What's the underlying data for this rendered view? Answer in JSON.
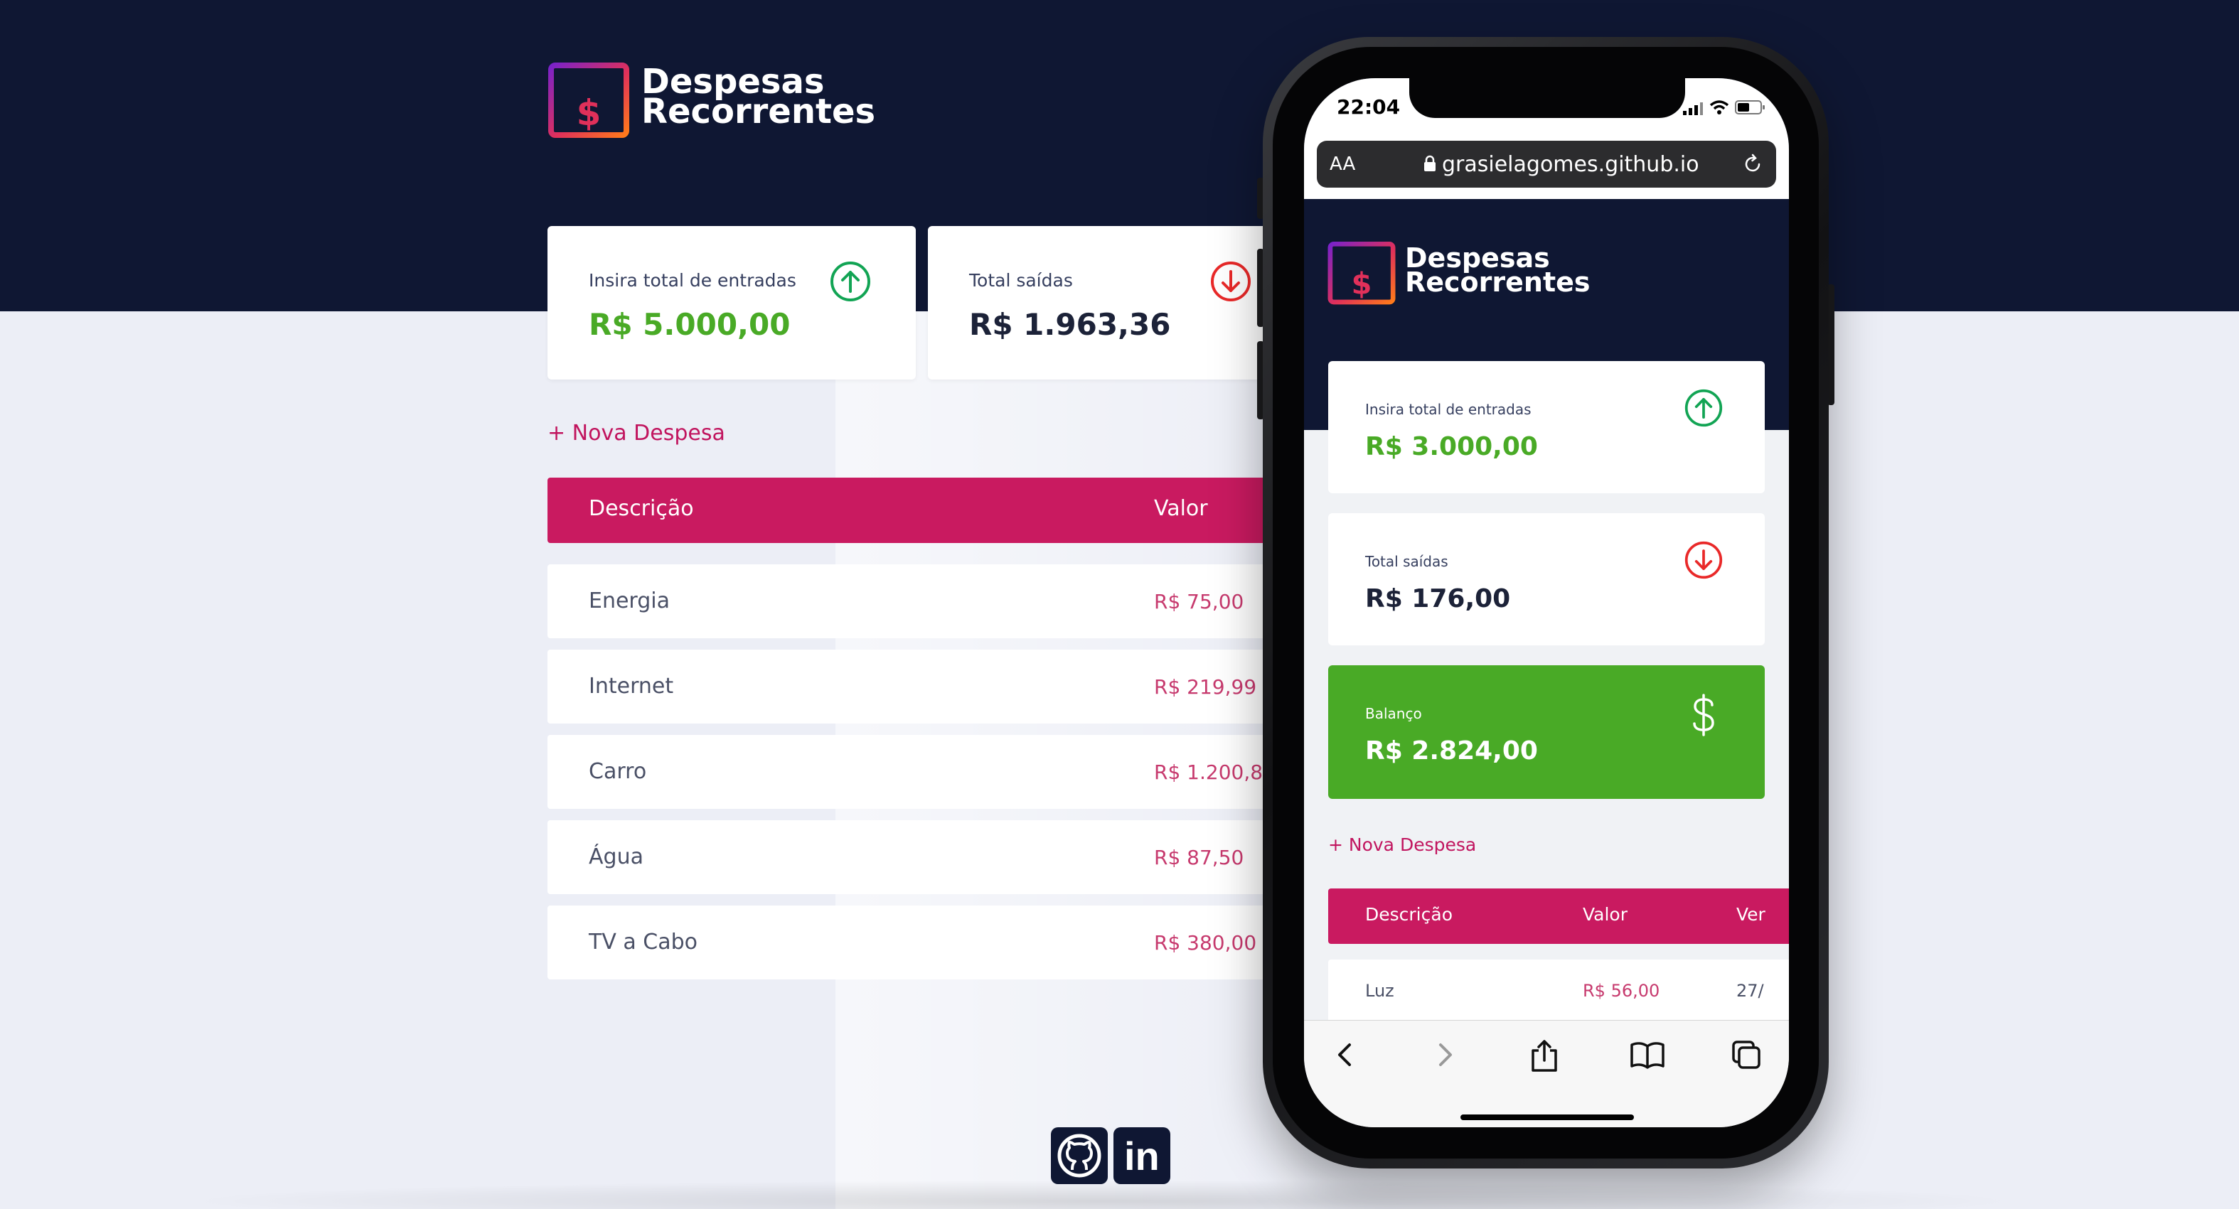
{
  "app": {
    "title_line1": "Despesas",
    "title_line2": "Recorrentes"
  },
  "desktop": {
    "income": {
      "label": "Insira total de entradas",
      "value": "R$ 5.000,00",
      "icon": "arrow-up-circle-icon"
    },
    "expenses": {
      "label": "Total saídas",
      "value": "R$ 1.963,36",
      "icon": "arrow-down-circle-icon"
    },
    "new_expense": "+ Nova Despesa",
    "table": {
      "headers": [
        "Descrição",
        "Valor"
      ],
      "rows": [
        {
          "description": "Energia",
          "value": "R$ 75,00"
        },
        {
          "description": "Internet",
          "value": "R$ 219,99"
        },
        {
          "description": "Carro",
          "value": "R$ 1.200,87"
        },
        {
          "description": "Água",
          "value": "R$ 87,50"
        },
        {
          "description": "TV a Cabo",
          "value": "R$ 380,00"
        }
      ]
    }
  },
  "footer": {
    "links": [
      {
        "name": "GitHub",
        "icon": "github-icon"
      },
      {
        "name": "LinkedIn",
        "icon": "linkedin-icon",
        "text": "in"
      }
    ]
  },
  "mobile": {
    "status": {
      "time": "22:04"
    },
    "browser": {
      "aa": "AA",
      "url": "grasielagomes.github.io"
    },
    "income": {
      "label": "Insira total de entradas",
      "value": "R$ 3.000,00"
    },
    "expenses": {
      "label": "Total saídas",
      "value": "R$ 176,00"
    },
    "balance": {
      "label": "Balanço",
      "value": "R$ 2.824,00",
      "icon": "dollar-sign-icon"
    },
    "new_expense": "+ Nova Despesa",
    "table": {
      "headers": [
        "Descrição",
        "Valor",
        "Ver"
      ],
      "rows": [
        {
          "description": "Luz",
          "value": "R$ 56,00",
          "date": "27/"
        }
      ]
    }
  },
  "colors": {
    "navy": "#0f1733",
    "background": "#eceef6",
    "accent": "#c91a60",
    "income_green": "#49aa26",
    "expense_red": "#e92929"
  }
}
